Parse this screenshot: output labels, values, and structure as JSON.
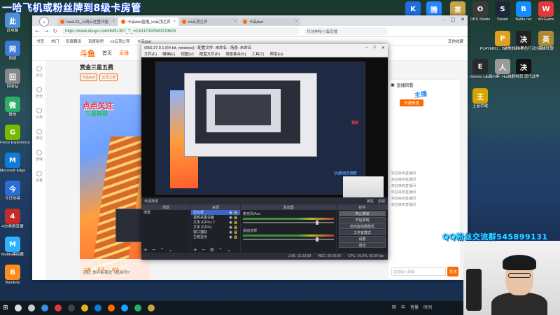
{
  "banner": {
    "top_text": "一哈飞机或粉丝牌到8级卡房管",
    "qq_text": "QQ粉丝交流群545899131"
  },
  "desktop_icons_left": [
    {
      "label": "此电脑",
      "icon": "computer-icon",
      "color": "#4a90d9"
    },
    {
      "label": "网络",
      "icon": "network-icon",
      "color": "#3a7bd5"
    },
    {
      "label": "回收站",
      "icon": "recycle-bin-icon",
      "color": "#888888"
    },
    {
      "label": "微信",
      "icon": "wechat-icon",
      "color": "#2aae67"
    },
    {
      "label": "GeForce Experience",
      "icon": "geforce-icon",
      "color": "#76b900"
    },
    {
      "label": "Microsoft Edge",
      "icon": "edge-icon",
      "color": "#0f7bd8"
    },
    {
      "label": "今日热榜",
      "icon": "news-icon",
      "color": "#2b6cd6"
    },
    {
      "label": "435美剧直播",
      "icon": "app-icon",
      "color": "#c62b2b"
    },
    {
      "label": "MuMu模拟器",
      "icon": "mumu-icon",
      "color": "#2bb3ff"
    },
    {
      "label": "Bandizip",
      "icon": "bandizip-icon",
      "color": "#ff8c1a"
    }
  ],
  "desktop_icons_right": [
    {
      "label": "K",
      "icon": "kugou-icon",
      "color": "#1f6fe0"
    },
    {
      "label": "腾讯视频",
      "icon": "tencent-video-icon",
      "color": "#2a86ff"
    },
    {
      "label": "英雄联盟",
      "icon": "league-icon",
      "color": "#c8a24a"
    },
    {
      "label": "OBS Studio",
      "icon": "obs-icon",
      "color": "#3a3a3a"
    },
    {
      "label": "Steam",
      "icon": "steam-icon",
      "color": "#1b2838"
    },
    {
      "label": "Battle.net",
      "icon": "battlenet-icon",
      "color": "#148eff"
    },
    {
      "label": "WeGame",
      "icon": "wegame-icon",
      "color": "#e23a3a"
    },
    {
      "label": "PLAYERU... BATTLEGR...",
      "icon": "pubg-icon",
      "color": "#e0a020"
    },
    {
      "label": "决胜时刻 黑色行动冷战",
      "icon": "cod-icon",
      "color": "#222222"
    },
    {
      "label": "英雄联盟",
      "icon": "league-icon",
      "color": "#b08a30"
    },
    {
      "label": "Epic Games Launcher",
      "icon": "epic-icon",
      "color": "#2a2a2a"
    },
    {
      "label": "人间一年: Human F...",
      "icon": "game-icon",
      "color": "#9a9a9a"
    },
    {
      "label": "决胜时刻 现代战争",
      "icon": "mw-icon",
      "color": "#111111"
    },
    {
      "label": "王者荣耀",
      "icon": "honor-icon",
      "color": "#d6a500"
    }
  ],
  "browser": {
    "tabs": [
      {
        "title": "hao123_上网从这里开始",
        "active": false
      },
      {
        "title": "卡品dad直播_lol云顶之弈",
        "active": true
      },
      {
        "title": "lol云顶之弈",
        "active": false
      },
      {
        "title": "卡品dad",
        "active": false
      }
    ],
    "url": "https://www.douyu.com/6451357_?_=0.6117392540219625",
    "search_placeholder": "月球神秘小蛋直播",
    "bookmarks": [
      "书签",
      "热门",
      "百度翻译",
      "百度贴吧",
      "lol云顶之弈",
      "卡品dad"
    ],
    "bookmark_right": "其他收藏"
  },
  "douyu": {
    "logo": "斗鱼",
    "nav": [
      "首页",
      "直播"
    ],
    "active_nav": "直播",
    "room_title": "赏金三星五费",
    "room_badges": [
      "卡品dad",
      "云顶之弈"
    ],
    "video_follow": "点点关注",
    "video_follow2": "三星阵容",
    "video_chips": [
      "下载",
      "618",
      "开播"
    ],
    "message_bar": "【系】你可能喜欢飞机哈吗?",
    "rail": [
      "关注",
      "历史",
      "分类",
      "排行",
      "游戏",
      "设置"
    ],
    "right_panel_title": "直播回看",
    "right_panel_button": "开通贵族",
    "chat_rows": [
      "欢迎来到直播间",
      "欢迎来到直播间",
      "欢迎来到直播间",
      "欢迎来到直播间",
      "欢迎来到直播间",
      "欢迎来到直播间"
    ],
    "chat_placeholder": "这里输入弹幕",
    "send_label": "发送",
    "mascot": "主播"
  },
  "obs": {
    "title": "OBS 27.0.1 (64-bit, windows) - 配置文件: 未命名 - 场景: 未命名",
    "menu": [
      "文件(F)",
      "编辑(E)",
      "视图(V)",
      "配置文件(P)",
      "场景集合(S)",
      "工具(T)",
      "帮助(H)"
    ],
    "status_left": "未选择源",
    "status_actions": [
      "属性",
      "滤镜"
    ],
    "docks": {
      "scenes": {
        "title": "场景",
        "items": [
          "场景"
        ]
      },
      "sources": {
        "title": "来源",
        "items": [
          "鼠标框",
          "视频采集设备",
          "文本 (GDI+) 2",
          "文本 (GDI+)",
          "窗口捕获",
          "主题显示"
        ]
      },
      "mixer": {
        "title": "混音器",
        "tracks": [
          "麦克风/Aux",
          "桌面音频"
        ]
      },
      "controls": {
        "title": "控件",
        "buttons": [
          "停止推流",
          "开始录制",
          "启动虚拟摄像机",
          "工作室模式",
          "设置",
          "退出"
        ]
      }
    },
    "preview_cam_text": "QQ粉丝交流群",
    "preview_rec_text": "录制",
    "statusbar": [
      "LIVE: 01:23:58",
      "REC: 00:00:00",
      "CPU: 16.5%, 60.00 fps"
    ]
  },
  "taskbar": {
    "items": [
      "start",
      "search",
      "task-view",
      "browser",
      "wps",
      "obs",
      "chrome",
      "edge",
      "douyu",
      "qq",
      "wechat",
      "game"
    ],
    "tray": [
      "网",
      "中",
      "音量",
      "时间"
    ]
  }
}
